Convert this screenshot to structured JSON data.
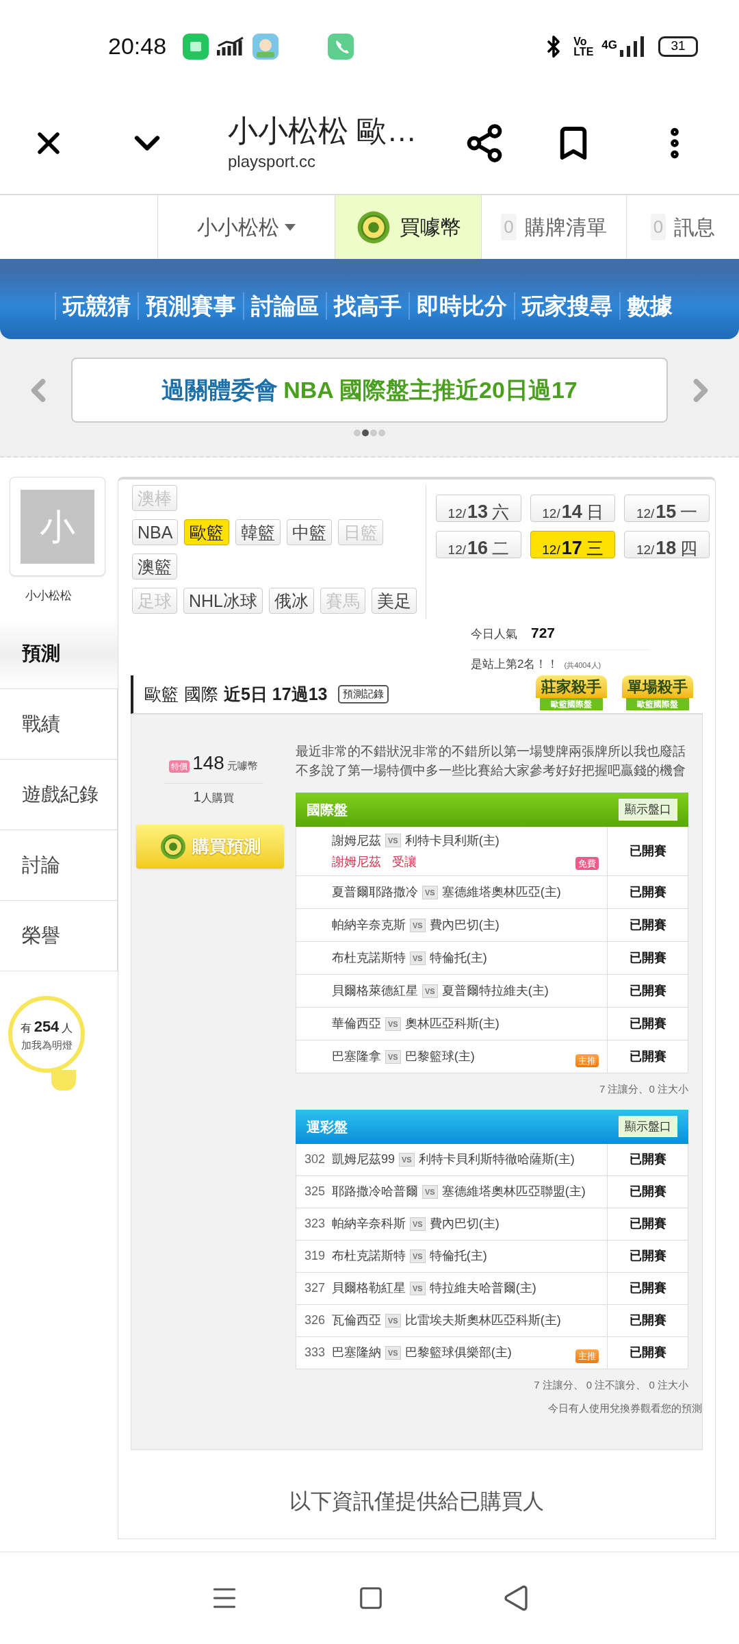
{
  "status_bar": {
    "time": "20:48",
    "vo": "Vo",
    "lte": "LTE",
    "network": "4G",
    "battery": "31"
  },
  "browser": {
    "title": "小小松松 歐…",
    "url": "playsport.cc"
  },
  "account_bar": {
    "user": "小小松松",
    "buy_coins": "買噱幣",
    "cart_count": "0",
    "cart": "購牌清單",
    "message_count": "0",
    "messages": "訊息"
  },
  "nav": [
    "玩競猜",
    "預測賽事",
    "討論區",
    "找高手",
    "即時比分",
    "玩家搜尋",
    "數據"
  ],
  "banner": {
    "name": "過關體委會",
    "headline": "NBA 國際盤主推近20日過17",
    "dots": [
      {
        "selected": false
      },
      {
        "selected": true
      },
      {
        "selected": false
      },
      {
        "selected": false
      }
    ]
  },
  "profile": {
    "avatar_letter": "小",
    "name": "小小松松"
  },
  "side_tabs": [
    {
      "label": "預測",
      "selected": true
    },
    {
      "label": "戰績",
      "selected": false
    },
    {
      "label": "遊戲紀錄",
      "selected": false
    },
    {
      "label": "討論",
      "selected": false
    },
    {
      "label": "榮譽",
      "selected": false
    }
  ],
  "fans": {
    "prefix": "有",
    "count": "254",
    "suffix": "人",
    "caption": "加我為明燈"
  },
  "sport_rows": [
    [
      {
        "label": "澳棒",
        "selected": false,
        "disabled": true
      }
    ],
    [
      {
        "label": "NBA",
        "selected": false,
        "disabled": false
      },
      {
        "label": "歐籃",
        "selected": true,
        "disabled": false
      },
      {
        "label": "韓籃",
        "selected": false,
        "disabled": false
      },
      {
        "label": "中籃",
        "selected": false,
        "disabled": false
      },
      {
        "label": "日籃",
        "selected": false,
        "disabled": true
      }
    ],
    [
      {
        "label": "澳籃",
        "selected": false,
        "disabled": false
      }
    ],
    [
      {
        "label": "足球",
        "selected": false,
        "disabled": true
      },
      {
        "label": "NHL冰球",
        "selected": false,
        "disabled": false
      },
      {
        "label": "俄冰",
        "selected": false,
        "disabled": false
      },
      {
        "label": "賽馬",
        "selected": false,
        "disabled": true
      },
      {
        "label": "美足",
        "selected": false,
        "disabled": false
      }
    ]
  ],
  "dates": [
    {
      "month": "12/",
      "day": "13",
      "weekday": "六",
      "selected": false
    },
    {
      "month": "12/",
      "day": "14",
      "weekday": "日",
      "selected": false
    },
    {
      "month": "12/",
      "day": "15",
      "weekday": "一",
      "selected": false
    },
    {
      "month": "12/",
      "day": "16",
      "weekday": "二",
      "selected": false
    },
    {
      "month": "12/",
      "day": "17",
      "weekday": "三",
      "selected": true
    },
    {
      "month": "12/",
      "day": "18",
      "weekday": "四",
      "selected": false
    }
  ],
  "popularity": {
    "label": "今日人氣",
    "value": "727",
    "rank": "是站上第2名！！",
    "total": "(共4004人)"
  },
  "prediction": {
    "league": "歐籃",
    "market": "國際",
    "record": "近5日 17過13",
    "record_button": "預測記錄",
    "badges": [
      {
        "title": "莊家殺手",
        "ribbon": "歐籃國際盤"
      },
      {
        "title": "單場殺手",
        "ribbon": "歐籃國際盤"
      }
    ],
    "price_tag": "特價",
    "price": "148",
    "price_unit": "元噱幣",
    "buyers": "1",
    "buyers_unit": "人購買",
    "buy_button": "購買預測",
    "description": "最近非常的不錯狀況非常的不錯所以第一場雙牌兩張牌所以我也廢話不多說了第一場特價中多一些比賽給大家參考好好把握吧贏錢的機會"
  },
  "tables": [
    {
      "kind": "international",
      "title": "國際盤",
      "button": "顯示盤口",
      "rows": [
        {
          "away": "謝姆尼茲",
          "vs": "VS",
          "home": "利特卡貝利斯(主)",
          "pick_team": "謝姆尼茲",
          "pick_type": "受讓",
          "tag": {
            "kind": "free",
            "label": "免費"
          },
          "status": "已開賽"
        },
        {
          "away": "夏普爾耶路撒冷",
          "vs": "VS",
          "home": "塞德維塔奧林匹亞(主)",
          "status": "已開賽"
        },
        {
          "away": "帕納辛奈克斯",
          "vs": "VS",
          "home": "費內巴切(主)",
          "status": "已開賽"
        },
        {
          "away": "布杜克諾斯特",
          "vs": "VS",
          "home": "特倫托(主)",
          "status": "已開賽"
        },
        {
          "away": "貝爾格萊德紅星",
          "vs": "VS",
          "home": "夏普爾特拉維夫(主)",
          "status": "已開賽"
        },
        {
          "away": "華倫西亞",
          "vs": "VS",
          "home": "奧林匹亞科斯(主)",
          "status": "已開賽"
        },
        {
          "away": "巴塞隆拿",
          "vs": "VS",
          "home": "巴黎籃球(主)",
          "tag": {
            "kind": "main",
            "label": "主推"
          },
          "status": "已開賽"
        }
      ],
      "footer": [
        "7 注讓分、0 注大小"
      ]
    },
    {
      "kind": "sports_lottery",
      "title": "運彩盤",
      "button": "顯示盤口",
      "rows": [
        {
          "number": "302",
          "away": "凱姆尼茲99",
          "vs": "VS",
          "home": "利特卡貝利斯特徹哈薩斯(主)",
          "status": "已開賽"
        },
        {
          "number": "325",
          "away": "耶路撒冷哈普爾",
          "vs": "VS",
          "home": "塞德維塔奧林匹亞聯盟(主)",
          "status": "已開賽"
        },
        {
          "number": "323",
          "away": "帕納辛奈科斯",
          "vs": "VS",
          "home": "費內巴切(主)",
          "status": "已開賽"
        },
        {
          "number": "319",
          "away": "布杜克諾斯特",
          "vs": "VS",
          "home": "特倫托(主)",
          "status": "已開賽"
        },
        {
          "number": "327",
          "away": "貝爾格勒紅星",
          "vs": "VS",
          "home": "特拉維夫哈普爾(主)",
          "status": "已開賽"
        },
        {
          "number": "326",
          "away": "瓦倫西亞",
          "vs": "VS",
          "home": "比雷埃夫斯奧林匹亞科斯(主)",
          "status": "已開賽"
        },
        {
          "number": "333",
          "away": "巴塞隆納",
          "vs": "VS",
          "home": "巴黎籃球俱樂部(主)",
          "tag": {
            "kind": "main",
            "label": "主推"
          },
          "status": "已開賽"
        }
      ],
      "footer": [
        "7 注讓分、 0 注不讓分、 0 注大小",
        "今日有人使用兌換券觀看您的預測"
      ]
    }
  ],
  "locked_message": "以下資訊僅提供給已購買人"
}
